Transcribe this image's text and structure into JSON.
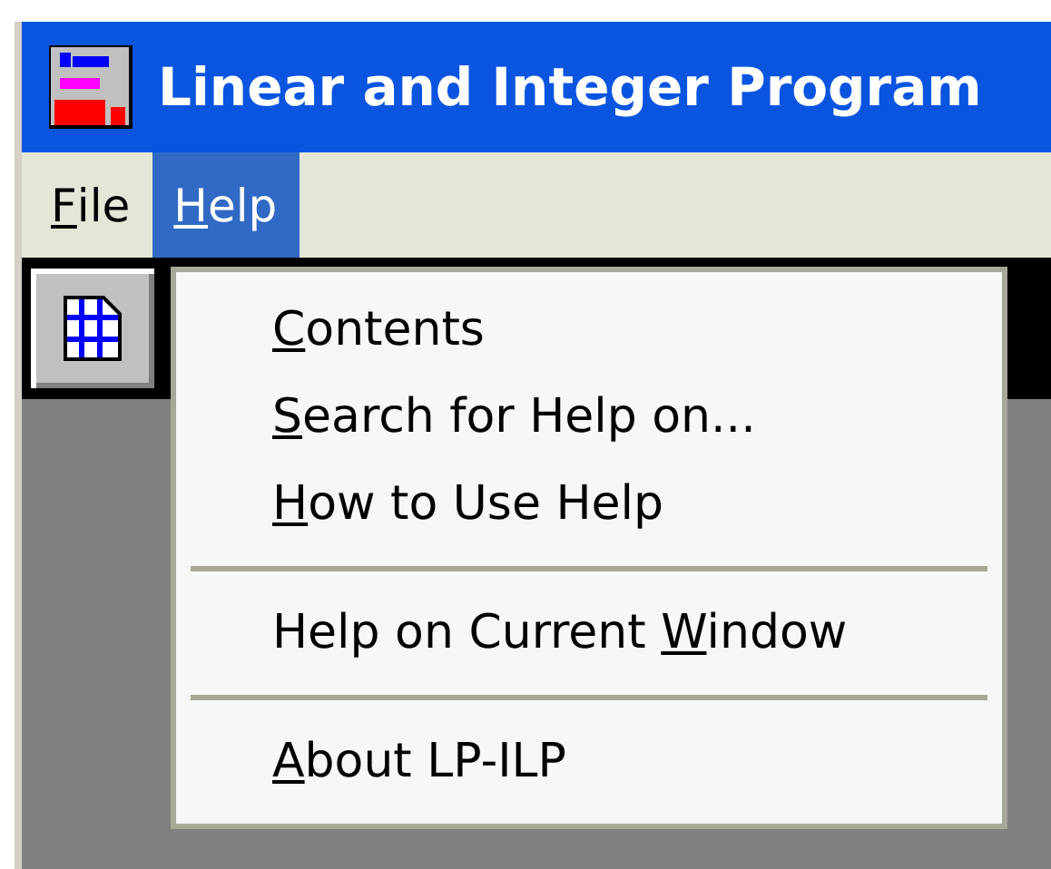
{
  "window": {
    "title": "Linear and Integer Program"
  },
  "menu_bar": [
    {
      "label": {
        "key": "F",
        "after": "ile"
      },
      "selected": false
    },
    {
      "label": {
        "key": "H",
        "after": "elp"
      },
      "selected": true
    }
  ],
  "help_menu": [
    {
      "kind": "item",
      "label": {
        "key": "C",
        "after": "ontents"
      }
    },
    {
      "kind": "item",
      "label": {
        "key": "S",
        "after": "earch for Help on..."
      }
    },
    {
      "kind": "item",
      "label": {
        "key": "H",
        "after": "ow to Use Help"
      }
    },
    {
      "kind": "separator"
    },
    {
      "kind": "item",
      "label": {
        "before": "Help on Current ",
        "key": "W",
        "after": "indow"
      }
    },
    {
      "kind": "separator"
    },
    {
      "kind": "item",
      "label": {
        "key": "A",
        "after": "bout LP-ILP"
      }
    }
  ]
}
